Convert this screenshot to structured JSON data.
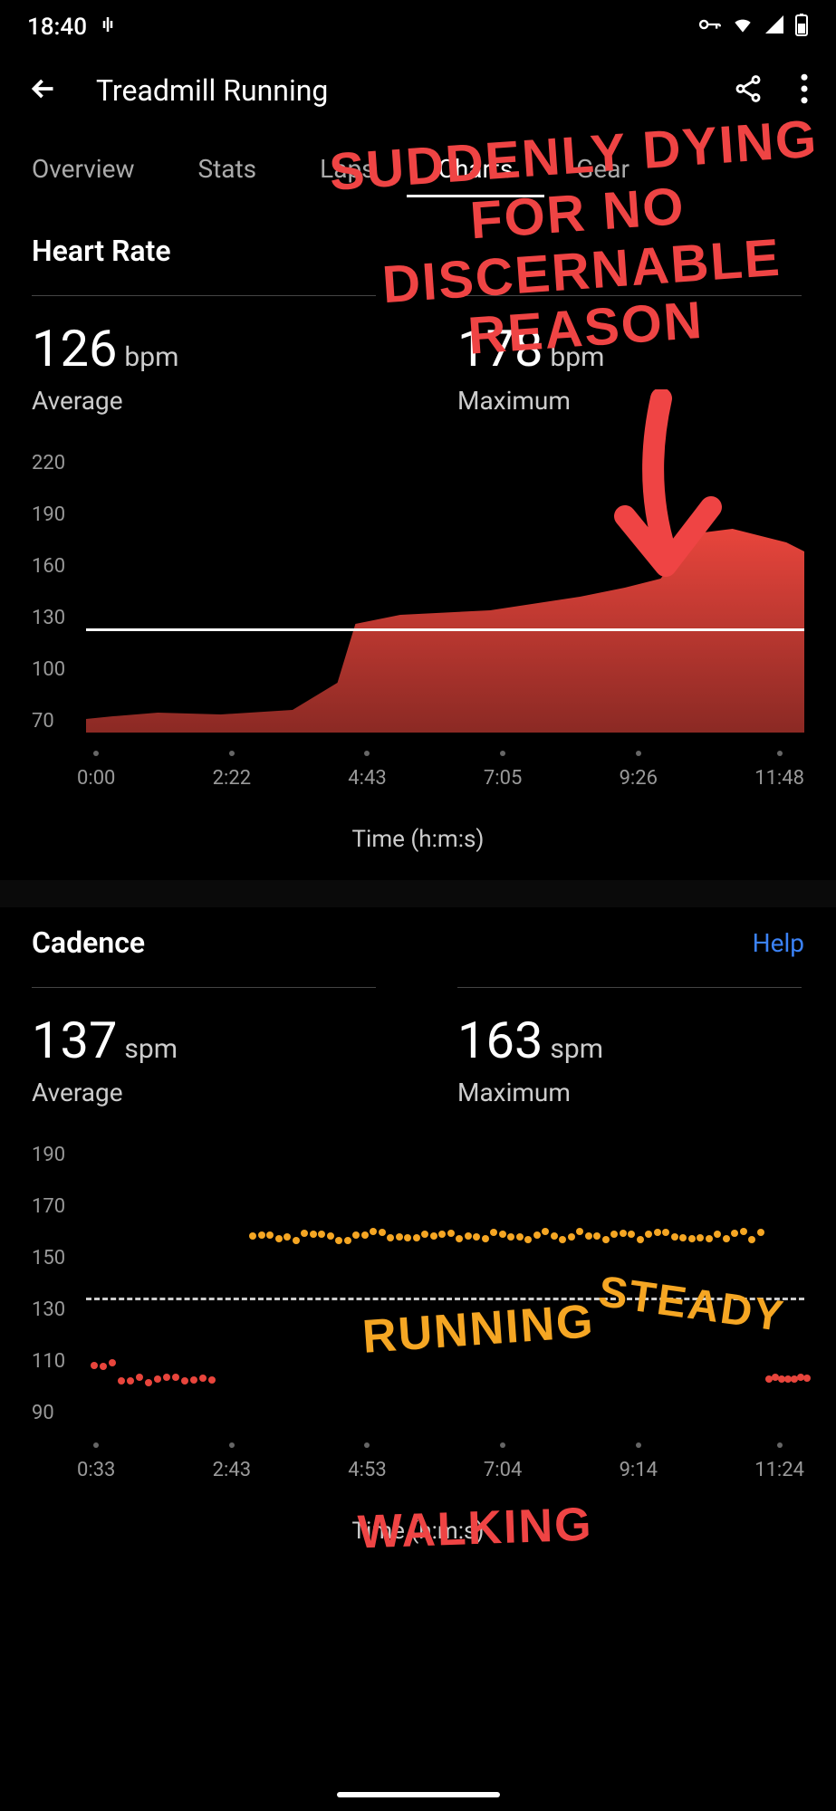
{
  "status": {
    "time": "18:40"
  },
  "header": {
    "title": "Treadmill Running"
  },
  "tabs": [
    "Overview",
    "Stats",
    "Laps",
    "Charts",
    "Gear"
  ],
  "active_tab": "Charts",
  "heart_rate": {
    "title": "Heart Rate",
    "avg_value": "126",
    "avg_unit": "bpm",
    "avg_label": "Average",
    "max_value": "178",
    "max_unit": "bpm",
    "max_label": "Maximum",
    "y_ticks": [
      "220",
      "190",
      "160",
      "130",
      "100",
      "70"
    ],
    "x_ticks": [
      "0:00",
      "2:22",
      "4:43",
      "7:05",
      "9:26",
      "11:48"
    ],
    "axis_label": "Time (h:m:s)"
  },
  "cadence": {
    "title": "Cadence",
    "help": "Help",
    "avg_value": "137",
    "avg_unit": "spm",
    "avg_label": "Average",
    "max_value": "163",
    "max_unit": "spm",
    "max_label": "Maximum",
    "y_ticks": [
      "190",
      "170",
      "150",
      "130",
      "110",
      "90"
    ],
    "x_ticks": [
      "0:33",
      "2:43",
      "4:53",
      "7:04",
      "9:14",
      "11:24"
    ],
    "axis_label": "Time (h:m:s)"
  },
  "annotations": {
    "top": "SUDDENLY DYING FOR NO DISCERNABLE REASON",
    "running": "RUNNING",
    "steady": "STEADY",
    "walking": "WALKING"
  },
  "chart_data": [
    {
      "type": "area",
      "title": "Heart Rate",
      "ylabel": "bpm",
      "xlabel": "Time (h:m:s)",
      "ylim": [
        70,
        220
      ],
      "reference": 126,
      "x": [
        "0:00",
        "2:22",
        "4:43",
        "7:05",
        "9:26",
        "11:48"
      ],
      "values": [
        78,
        82,
        130,
        135,
        145,
        178
      ]
    },
    {
      "type": "scatter",
      "title": "Cadence",
      "ylabel": "spm",
      "xlabel": "Time (h:m:s)",
      "ylim": [
        90,
        190
      ],
      "reference": 137,
      "series": [
        {
          "name": "walking",
          "color": "#e8453c",
          "y_approx": 110
        },
        {
          "name": "running",
          "color": "#f5a623",
          "y_approx": 160
        }
      ],
      "x": [
        "0:33",
        "2:43",
        "4:53",
        "7:04",
        "9:14",
        "11:24"
      ]
    }
  ]
}
